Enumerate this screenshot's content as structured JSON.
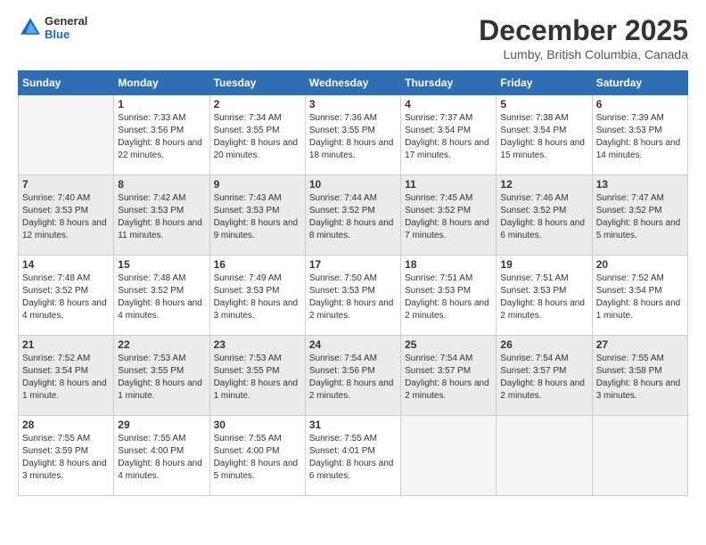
{
  "header": {
    "logo_general": "General",
    "logo_blue": "Blue",
    "month_title": "December 2025",
    "location": "Lumby, British Columbia, Canada"
  },
  "weekdays": [
    "Sunday",
    "Monday",
    "Tuesday",
    "Wednesday",
    "Thursday",
    "Friday",
    "Saturday"
  ],
  "weeks": [
    [
      {
        "day": "",
        "empty": true
      },
      {
        "day": "1",
        "sunrise": "7:33 AM",
        "sunset": "3:56 PM",
        "daylight": "8 hours and 22 minutes."
      },
      {
        "day": "2",
        "sunrise": "7:34 AM",
        "sunset": "3:55 PM",
        "daylight": "8 hours and 20 minutes."
      },
      {
        "day": "3",
        "sunrise": "7:36 AM",
        "sunset": "3:55 PM",
        "daylight": "8 hours and 18 minutes."
      },
      {
        "day": "4",
        "sunrise": "7:37 AM",
        "sunset": "3:54 PM",
        "daylight": "8 hours and 17 minutes."
      },
      {
        "day": "5",
        "sunrise": "7:38 AM",
        "sunset": "3:54 PM",
        "daylight": "8 hours and 15 minutes."
      },
      {
        "day": "6",
        "sunrise": "7:39 AM",
        "sunset": "3:53 PM",
        "daylight": "8 hours and 14 minutes."
      }
    ],
    [
      {
        "day": "7",
        "sunrise": "7:40 AM",
        "sunset": "3:53 PM",
        "daylight": "8 hours and 12 minutes."
      },
      {
        "day": "8",
        "sunrise": "7:42 AM",
        "sunset": "3:53 PM",
        "daylight": "8 hours and 11 minutes."
      },
      {
        "day": "9",
        "sunrise": "7:43 AM",
        "sunset": "3:53 PM",
        "daylight": "8 hours and 9 minutes."
      },
      {
        "day": "10",
        "sunrise": "7:44 AM",
        "sunset": "3:52 PM",
        "daylight": "8 hours and 8 minutes."
      },
      {
        "day": "11",
        "sunrise": "7:45 AM",
        "sunset": "3:52 PM",
        "daylight": "8 hours and 7 minutes."
      },
      {
        "day": "12",
        "sunrise": "7:46 AM",
        "sunset": "3:52 PM",
        "daylight": "8 hours and 6 minutes."
      },
      {
        "day": "13",
        "sunrise": "7:47 AM",
        "sunset": "3:52 PM",
        "daylight": "8 hours and 5 minutes."
      }
    ],
    [
      {
        "day": "14",
        "sunrise": "7:48 AM",
        "sunset": "3:52 PM",
        "daylight": "8 hours and 4 minutes."
      },
      {
        "day": "15",
        "sunrise": "7:48 AM",
        "sunset": "3:52 PM",
        "daylight": "8 hours and 4 minutes."
      },
      {
        "day": "16",
        "sunrise": "7:49 AM",
        "sunset": "3:53 PM",
        "daylight": "8 hours and 3 minutes."
      },
      {
        "day": "17",
        "sunrise": "7:50 AM",
        "sunset": "3:53 PM",
        "daylight": "8 hours and 2 minutes."
      },
      {
        "day": "18",
        "sunrise": "7:51 AM",
        "sunset": "3:53 PM",
        "daylight": "8 hours and 2 minutes."
      },
      {
        "day": "19",
        "sunrise": "7:51 AM",
        "sunset": "3:53 PM",
        "daylight": "8 hours and 2 minutes."
      },
      {
        "day": "20",
        "sunrise": "7:52 AM",
        "sunset": "3:54 PM",
        "daylight": "8 hours and 1 minute."
      }
    ],
    [
      {
        "day": "21",
        "sunrise": "7:52 AM",
        "sunset": "3:54 PM",
        "daylight": "8 hours and 1 minute."
      },
      {
        "day": "22",
        "sunrise": "7:53 AM",
        "sunset": "3:55 PM",
        "daylight": "8 hours and 1 minute."
      },
      {
        "day": "23",
        "sunrise": "7:53 AM",
        "sunset": "3:55 PM",
        "daylight": "8 hours and 1 minute."
      },
      {
        "day": "24",
        "sunrise": "7:54 AM",
        "sunset": "3:56 PM",
        "daylight": "8 hours and 2 minutes."
      },
      {
        "day": "25",
        "sunrise": "7:54 AM",
        "sunset": "3:57 PM",
        "daylight": "8 hours and 2 minutes."
      },
      {
        "day": "26",
        "sunrise": "7:54 AM",
        "sunset": "3:57 PM",
        "daylight": "8 hours and 2 minutes."
      },
      {
        "day": "27",
        "sunrise": "7:55 AM",
        "sunset": "3:58 PM",
        "daylight": "8 hours and 3 minutes."
      }
    ],
    [
      {
        "day": "28",
        "sunrise": "7:55 AM",
        "sunset": "3:59 PM",
        "daylight": "8 hours and 3 minutes."
      },
      {
        "day": "29",
        "sunrise": "7:55 AM",
        "sunset": "4:00 PM",
        "daylight": "8 hours and 4 minutes."
      },
      {
        "day": "30",
        "sunrise": "7:55 AM",
        "sunset": "4:00 PM",
        "daylight": "8 hours and 5 minutes."
      },
      {
        "day": "31",
        "sunrise": "7:55 AM",
        "sunset": "4:01 PM",
        "daylight": "8 hours and 6 minutes."
      },
      {
        "day": "",
        "empty": true
      },
      {
        "day": "",
        "empty": true
      },
      {
        "day": "",
        "empty": true
      }
    ]
  ],
  "labels": {
    "sunrise": "Sunrise:",
    "sunset": "Sunset:",
    "daylight": "Daylight:"
  }
}
